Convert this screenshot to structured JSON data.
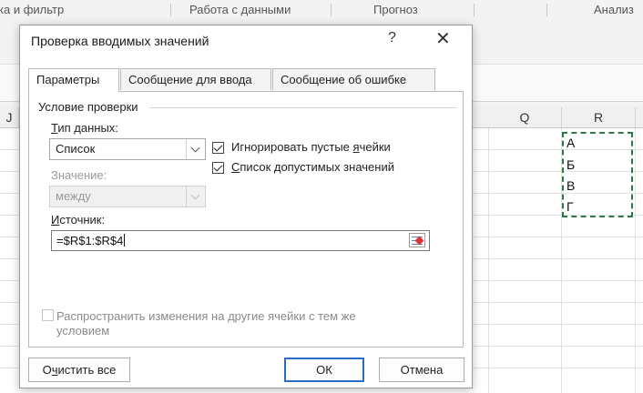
{
  "ribbon": {
    "groups": [
      "ка и фильтр",
      "Работа с данными",
      "Прогноз",
      "Анализ"
    ]
  },
  "sheet": {
    "columns": {
      "j": "J",
      "q": "Q",
      "r": "R"
    },
    "cells_r": [
      "А",
      "Б",
      "В",
      "Г"
    ]
  },
  "dialog": {
    "title": "Проверка вводимых значений",
    "help": "?",
    "close": "✕",
    "tabs": [
      "Параметры",
      "Сообщение для ввода",
      "Сообщение об ошибке"
    ],
    "active_tab": 0,
    "group_label": "Условие проверки",
    "type_label_u": "Т",
    "type_label_rest": "ип данных:",
    "type_value": "Список",
    "value_label": "Значение:",
    "value_value": "между",
    "ignore_blank": {
      "checked": true,
      "label_pre": "Игнорировать пустые ",
      "label_u": "я",
      "label_post": "чейки"
    },
    "in_cell_dropdown": {
      "checked": true,
      "label_u": "С",
      "label_rest": "писок допустимых значений"
    },
    "source_label_u": "И",
    "source_label_rest": "сточник:",
    "source_value": "=$R$1:$R$4",
    "apply_all": {
      "checked": false,
      "label_line1": "Распространить изменения на другие ячейки с тем же",
      "label_line2": "условием"
    },
    "buttons": {
      "clear_pre": "О",
      "clear_u": "ч",
      "clear_rest": "истить все",
      "ok": "ОК",
      "cancel": "Отмена"
    }
  },
  "colors": {
    "marquee": "#2a7a3e",
    "ok_border": "#2a6dc2"
  }
}
